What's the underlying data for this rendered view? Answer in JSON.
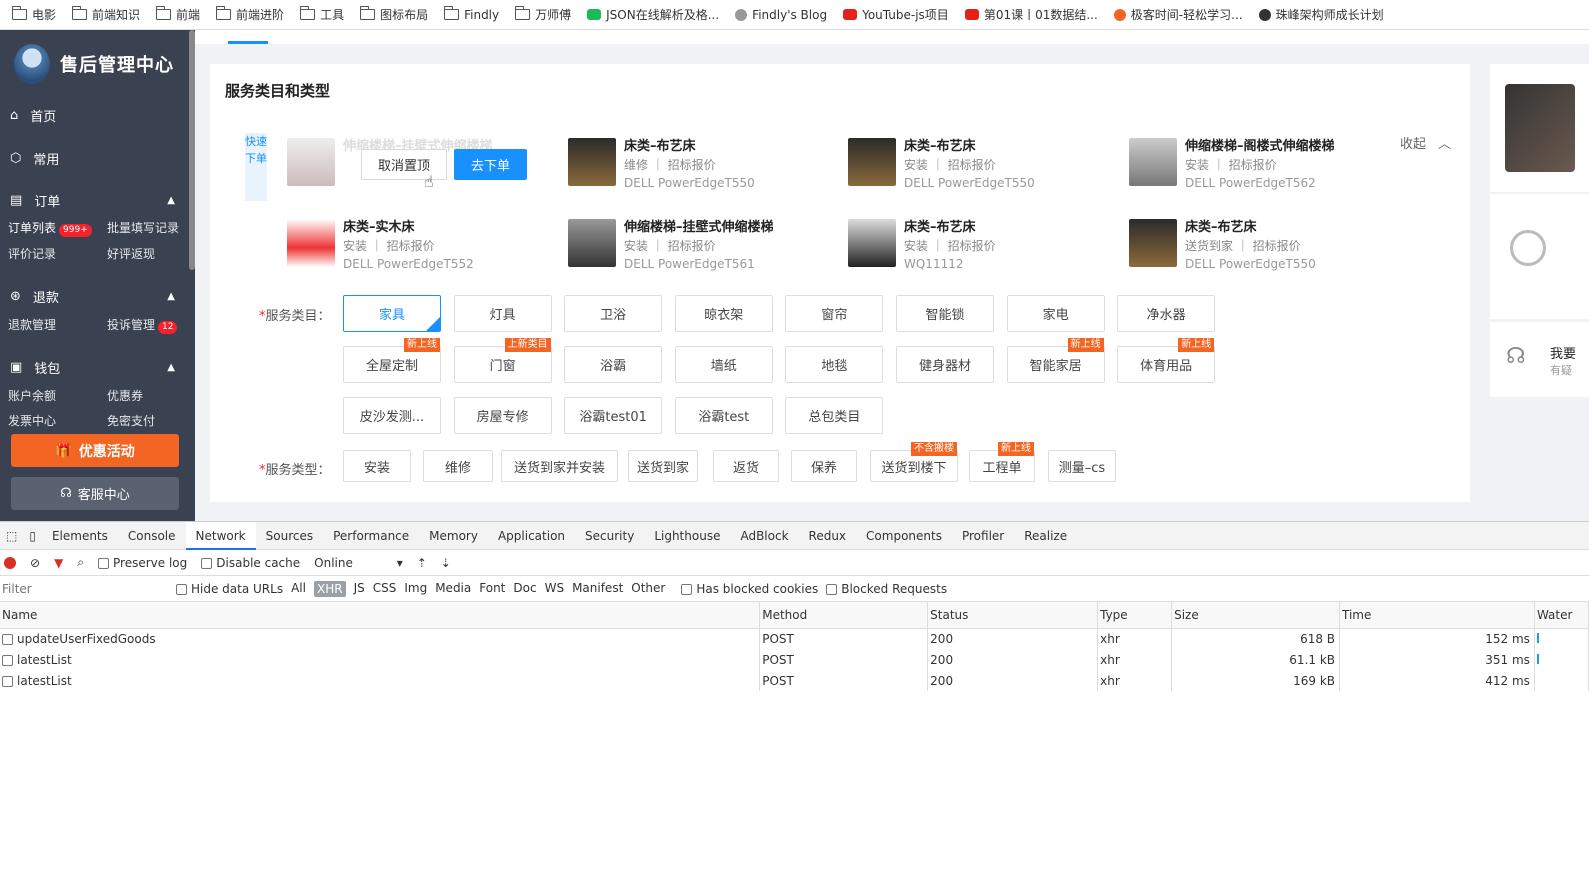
{
  "bookmarks": [
    {
      "label": "电影",
      "icon": "folder-icon"
    },
    {
      "label": "前端知识",
      "icon": "folder-icon"
    },
    {
      "label": "前端",
      "icon": "folder-icon"
    },
    {
      "label": "前端进阶",
      "icon": "folder-icon"
    },
    {
      "label": "工具",
      "icon": "folder-icon"
    },
    {
      "label": "图标布局",
      "icon": "folder-icon"
    },
    {
      "label": "Findly",
      "icon": "folder-icon"
    },
    {
      "label": "万师傅",
      "icon": "folder-icon"
    },
    {
      "label": "JSON在线解析及格...",
      "icon": "json-favicon"
    },
    {
      "label": "Findly's Blog",
      "icon": "blog-favicon"
    },
    {
      "label": "YouTube-js项目",
      "icon": "youtube-icon"
    },
    {
      "label": "第01课丨01数据结...",
      "icon": "youtube-icon"
    },
    {
      "label": "极客时间-轻松学习...",
      "icon": "geek-favicon"
    },
    {
      "label": "珠峰架构师成长计划",
      "icon": "globe-icon"
    }
  ],
  "sidebar": {
    "title": "售后管理中心",
    "home": "首页",
    "common": "常用",
    "orders": "订单",
    "order_list": "订单列表",
    "order_badge": "999+",
    "batch_fill": "批量填写记录",
    "reviews": "评价记录",
    "good_review": "好评返现",
    "refund": "退款",
    "refund_mgmt": "退款管理",
    "complaint": "投诉管理",
    "complaint_badge": "12",
    "wallet": "钱包",
    "balance": "账户余额",
    "coupon": "优惠券",
    "invoice": "发票中心",
    "free_pay": "免密支付",
    "promo": "优惠活动",
    "service": "客服中心"
  },
  "card": {
    "title": "服务类目和类型",
    "quick_order": "快速下单",
    "collapse": "收起",
    "unpin": "取消置顶",
    "go_order": "去下单",
    "products": [
      {
        "name": "伸缩楼梯–挂壁式伸缩楼梯",
        "meta": "",
        "sku": ""
      },
      {
        "name": "床类–布艺床",
        "meta": "维修 ｜ 招标报价",
        "sku": "DELL PowerEdgeT550"
      },
      {
        "name": "床类–布艺床",
        "meta": "安装 ｜ 招标报价",
        "sku": "DELL PowerEdgeT550"
      },
      {
        "name": "伸缩楼梯–阁楼式伸缩楼梯",
        "meta": "安装 ｜ 招标报价",
        "sku": "DELL PowerEdgeT562"
      },
      {
        "name": "床类–实木床",
        "meta": "安装 ｜ 招标报价",
        "sku": "DELL PowerEdgeT552"
      },
      {
        "name": "伸缩楼梯–挂壁式伸缩楼梯",
        "meta": "安装 ｜ 招标报价",
        "sku": "DELL PowerEdgeT561"
      },
      {
        "name": "床类–布艺床",
        "meta": "安装 ｜ 招标报价",
        "sku": "WQ11112"
      },
      {
        "name": "床类–布艺床",
        "meta": "送货到家 ｜ 招标报价",
        "sku": "DELL PowerEdgeT550"
      }
    ],
    "category_label": "服务类目：",
    "categories": [
      {
        "label": "家具",
        "tag": ""
      },
      {
        "label": "灯具",
        "tag": ""
      },
      {
        "label": "卫浴",
        "tag": ""
      },
      {
        "label": "晾衣架",
        "tag": ""
      },
      {
        "label": "窗帘",
        "tag": ""
      },
      {
        "label": "智能锁",
        "tag": ""
      },
      {
        "label": "家电",
        "tag": ""
      },
      {
        "label": "净水器",
        "tag": ""
      },
      {
        "label": "全屋定制",
        "tag": "新上线"
      },
      {
        "label": "门窗",
        "tag": "上新类目"
      },
      {
        "label": "浴霸",
        "tag": ""
      },
      {
        "label": "墙纸",
        "tag": ""
      },
      {
        "label": "地毯",
        "tag": ""
      },
      {
        "label": "健身器材",
        "tag": ""
      },
      {
        "label": "智能家居",
        "tag": "新上线"
      },
      {
        "label": "体育用品",
        "tag": "新上线"
      },
      {
        "label": "皮沙发测...",
        "tag": ""
      },
      {
        "label": "房屋专修",
        "tag": ""
      },
      {
        "label": "浴霸test01",
        "tag": ""
      },
      {
        "label": "浴霸test",
        "tag": ""
      },
      {
        "label": "总包类目",
        "tag": ""
      }
    ],
    "type_label": "服务类型：",
    "types": [
      {
        "label": "安装",
        "tag": ""
      },
      {
        "label": "维修",
        "tag": ""
      },
      {
        "label": "送货到家并安装",
        "tag": ""
      },
      {
        "label": "送货到家",
        "tag": ""
      },
      {
        "label": "返货",
        "tag": ""
      },
      {
        "label": "保养",
        "tag": ""
      },
      {
        "label": "送货到楼下",
        "tag": "不含搬楼"
      },
      {
        "label": "工程单",
        "tag": "新上线"
      },
      {
        "label": "测量–cs",
        "tag": ""
      }
    ]
  },
  "right_panel": {
    "line1": "我要",
    "line2": "有疑"
  },
  "devtools": {
    "tabs": [
      "Elements",
      "Console",
      "Network",
      "Sources",
      "Performance",
      "Memory",
      "Application",
      "Security",
      "Lighthouse",
      "AdBlock",
      "Redux",
      "Components",
      "Profiler",
      "Realize"
    ],
    "active_tab": "Network",
    "preserve_log": "Preserve log",
    "disable_cache": "Disable cache",
    "throttle": "Online",
    "filter_placeholder": "Filter",
    "hide_data_urls": "Hide data URLs",
    "types": [
      "All",
      "XHR",
      "JS",
      "CSS",
      "Img",
      "Media",
      "Font",
      "Doc",
      "WS",
      "Manifest",
      "Other"
    ],
    "active_type": "XHR",
    "blocked_cookies": "Has blocked cookies",
    "blocked_requests": "Blocked Requests",
    "columns": [
      "Name",
      "Method",
      "Status",
      "Type",
      "Size",
      "Time",
      "Water"
    ],
    "rows": [
      {
        "name": "updateUserFixedGoods",
        "method": "POST",
        "status": "200",
        "type": "xhr",
        "size": "618 B",
        "time": "152 ms"
      },
      {
        "name": "latestList",
        "method": "POST",
        "status": "200",
        "type": "xhr",
        "size": "61.1 kB",
        "time": "351 ms"
      },
      {
        "name": "latestList",
        "method": "POST",
        "status": "200",
        "type": "xhr",
        "size": "169 kB",
        "time": "412 ms"
      }
    ]
  },
  "colors": {
    "primary": "#1890ff",
    "orange": "#f26522",
    "sidebar": "#3a4150"
  }
}
